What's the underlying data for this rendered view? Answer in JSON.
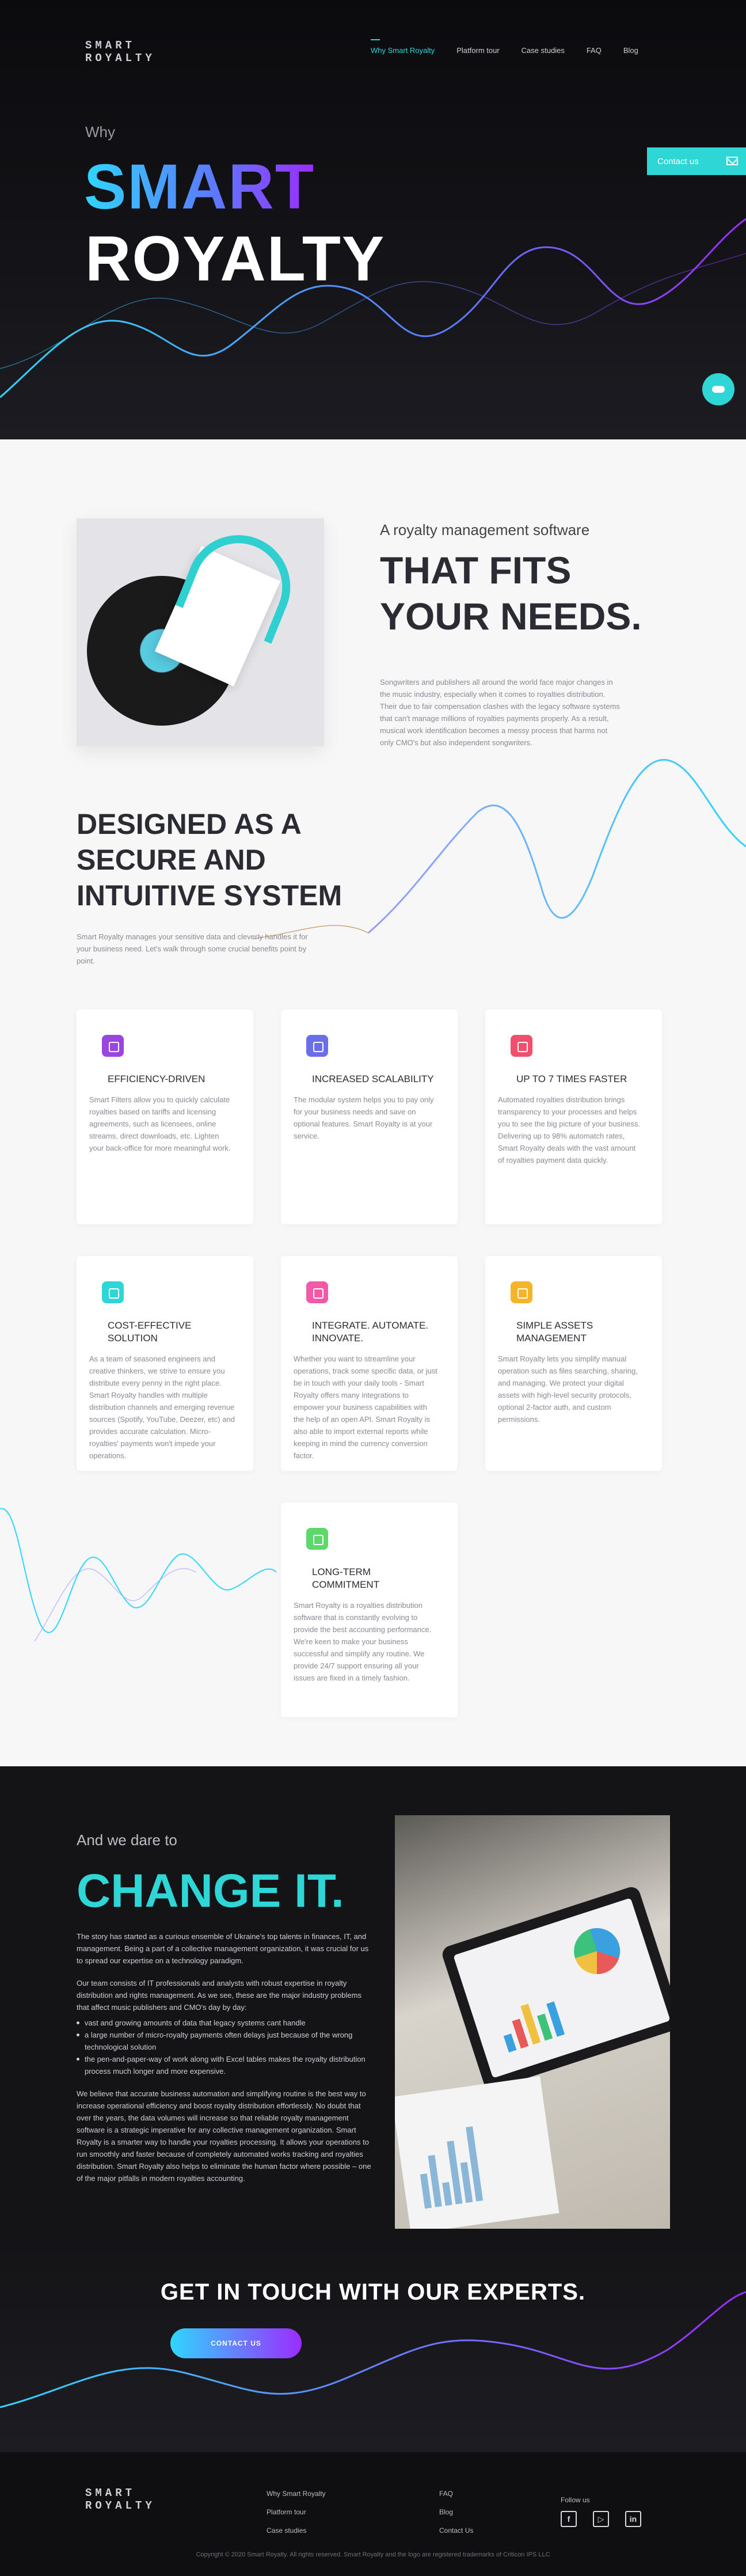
{
  "header": {
    "logo_line1": "SMART",
    "logo_line2": "ROYALTY",
    "nav": [
      "Why Smart Royalty",
      "Platform tour",
      "Case studies",
      "FAQ",
      "Blog"
    ]
  },
  "hero": {
    "why": "Why",
    "smart": "SMART",
    "royalty": "ROYALTY",
    "contact_tab": "Contact us"
  },
  "fits": {
    "subtitle": "A royalty management software",
    "title_line1": "THAT FITS",
    "title_line2": "YOUR NEEDS.",
    "paragraph": "Songwriters and publishers all around the world face major changes in the music industry, especially when it comes to royalties distribution. Their due to fair compensation clashes with the legacy software systems that can't manage millions of royalties payments properly. As a result, musical work identification becomes a messy process that harms not only CMO's but also independent songwriters."
  },
  "designed": {
    "line1": "DESIGNED AS A",
    "line2": "SECURE AND",
    "line3": "INTUITIVE SYSTEM",
    "paragraph": "Smart Royalty manages your sensitive data and cleverly handles it for your business need. Let's walk through some crucial benefits point by point."
  },
  "cards": [
    {
      "title": "EFFICIENCY-DRIVEN",
      "color": "#9b45e0",
      "text": "Smart Filters allow you to quickly calculate royalties based on tariffs and licensing agreements, such as licensees, online streams, direct downloads, etc. Lighten your back-office for more meaningful work."
    },
    {
      "title": "INCREASED SCALABILITY",
      "color": "#6a6ee8",
      "text": "The modular system helps you to pay only for your business needs and save on optional features. Smart Royalty is at your service."
    },
    {
      "title": "UP TO 7 TIMES FASTER",
      "color": "#f0506e",
      "text": "Automated royalties distribution brings transparency to your processes and helps you to see the big picture of your business. Delivering up to 98% automatch rates, Smart Royalty deals with the vast amount of royalties payment data quickly."
    },
    {
      "title": "COST-EFFECTIVE SOLUTION",
      "color": "#2fd6d6",
      "text": "As a team of seasoned engineers and creative thinkers, we strive to ensure you distribute every penny in the right place. Smart Royalty handles with multiple distribution channels and emerging revenue sources (Spotify, YouTube, Deezer, etc) and provides accurate calculation. Micro-royalties' payments won't impede your operations."
    },
    {
      "title": "INTEGRATE. AUTOMATE. INNOVATE.",
      "color": "#f25aa8",
      "text": "Whether you want to streamline your operations, track some specific data, or just be in touch with your daily tools - Smart Royalty offers many integrations to empower your business capabilities with the help of an open API. Smart Royalty is also able to import external reports while keeping in mind the currency conversion factor."
    },
    {
      "title": "SIMPLE ASSETS MANAGEMENT",
      "color": "#f5b42a",
      "text": "Smart Royalty lets you simplify manual operation such as files searching, sharing, and managing. We protect your digital assets with high-level security protocols, optional 2-factor auth, and custom permissions."
    },
    {
      "title": "LONG-TERM COMMITMENT",
      "color": "#5ed86a",
      "text": "Smart Royalty is a royalties distribution software that is constantly evolving to provide the best accounting performance. We're keen to make your business successful and simplify any routine. We provide 24/7 support ensuring all your issues are fixed in a timely fashion."
    }
  ],
  "change": {
    "dare": "And we dare to",
    "title": "CHANGE IT.",
    "p1": "The story has started as a curious ensemble of Ukraine's top talents in finances, IT, and management. Being a part of a collective management organization, it was crucial for us to spread our expertise on a technology paradigm.",
    "p2": "Our team consists of IT professionals and analysts with robust expertise in royalty distribution and rights management. As we see, these are the major industry problems that affect music publishers and CMO's day by day:",
    "bullets": [
      "vast and growing amounts of data that legacy systems cant handle",
      "a large number of micro-royalty payments often delays just because of the wrong technological solution",
      "the pen-and-paper-way of work along with Excel tables makes the royalty distribution process much longer and more expensive."
    ],
    "p3": "We believe that accurate business automation and simplifying routine is the best way to increase operational efficiency and boost royalty distribution effortlessly. No doubt that over the years, the data volumes will increase so that reliable royalty management software is a strategic imperative for any collective management organization. Smart Royalty is a smarter way to handle your royalties processing. It allows your operations to run smoothly and faster because of completely automated works tracking and royalties distribution. Smart Royalty also helps to eliminate the human factor where possible – one of the major pitfalls in modern royalties accounting."
  },
  "contact": {
    "title": "GET IN TOUCH WITH OUR EXPERTS.",
    "button": "CONTACT US"
  },
  "footer": {
    "col1": [
      "Why Smart Royalty",
      "Platform tour",
      "Case studies"
    ],
    "col2": [
      "FAQ",
      "Blog",
      "Contact Us"
    ],
    "follow": "Follow us",
    "social": [
      "facebook-icon",
      "youtube-icon",
      "linkedin-icon"
    ],
    "copyright": "Copyright © 2020 Smart Royalty. All rights reserved. Smart Royalty and the logo are registered trademarks of Criticon IPS LLC"
  },
  "colors": {
    "accent": "#2fd6d6",
    "gradient_start": "#2fd6ff",
    "gradient_end": "#9b2cff"
  }
}
